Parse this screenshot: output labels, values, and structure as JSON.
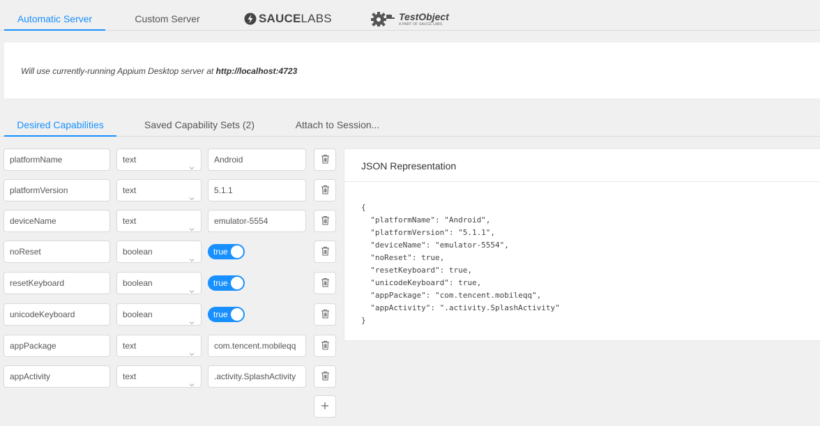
{
  "top_tabs": [
    {
      "label": "Automatic Server",
      "active": true
    },
    {
      "label": "Custom Server",
      "active": false
    }
  ],
  "logos": {
    "saucelabs": {
      "bold": "SAUCE",
      "light": "LABS",
      "icon": "saucelabs-logo-icon"
    },
    "testobject": {
      "name": "TestObject",
      "tagline": "A PART OF SAUCE LABS",
      "icon": "gear-robot-logo-icon"
    }
  },
  "server": {
    "message_prefix": "Will use currently-running Appium Desktop server at ",
    "url": "http://localhost:4723"
  },
  "cap_tabs": [
    {
      "label": "Desired Capabilities",
      "active": true
    },
    {
      "label": "Saved Capability Sets (2)",
      "active": false
    },
    {
      "label": "Attach to Session...",
      "active": false
    }
  ],
  "capabilities": [
    {
      "name": "platformName",
      "type": "text",
      "value": "Android"
    },
    {
      "name": "platformVersion",
      "type": "text",
      "value": "5.1.1"
    },
    {
      "name": "deviceName",
      "type": "text",
      "value": "emulator-5554"
    },
    {
      "name": "noReset",
      "type": "boolean",
      "value": "true"
    },
    {
      "name": "resetKeyboard",
      "type": "boolean",
      "value": "true"
    },
    {
      "name": "unicodeKeyboard",
      "type": "boolean",
      "value": "true"
    },
    {
      "name": "appPackage",
      "type": "text",
      "value": "com.tencent.mobileqq"
    },
    {
      "name": "appActivity",
      "type": "text",
      "value": ".activity.SplashActivity"
    }
  ],
  "json_panel": {
    "title": "JSON Representation",
    "lines": [
      "{",
      "  \"platformName\": \"Android\",",
      "  \"platformVersion\": \"5.1.1\",",
      "  \"deviceName\": \"emulator-5554\",",
      "  \"noReset\": true,",
      "  \"resetKeyboard\": true,",
      "  \"unicodeKeyboard\": true,",
      "  \"appPackage\": \"com.tencent.mobileqq\",",
      "  \"appActivity\": \".activity.SplashActivity\"",
      "}"
    ]
  },
  "colors": {
    "accent": "#1890ff",
    "border": "#d9d9d9",
    "background": "#f0f0f0"
  }
}
